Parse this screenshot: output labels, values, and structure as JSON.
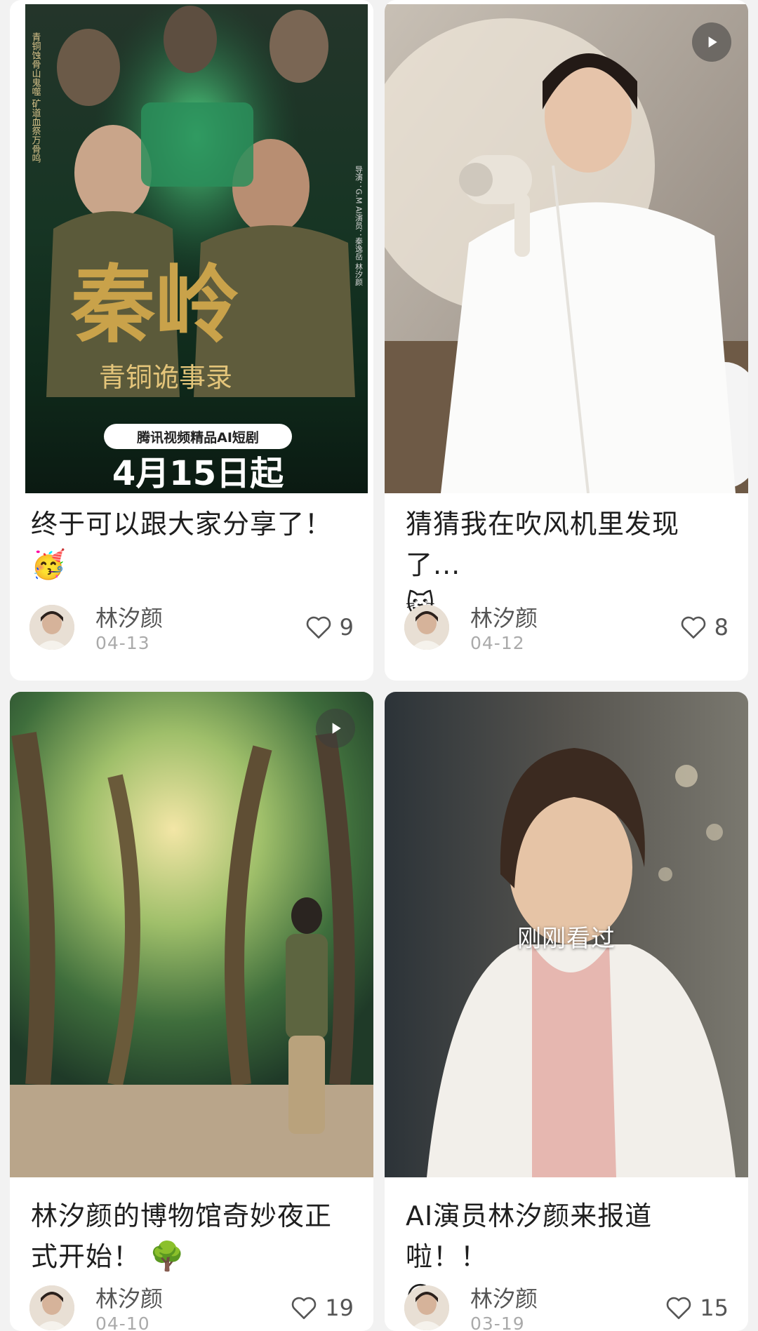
{
  "cards": [
    {
      "title": "终于可以跟大家分享了！",
      "emoji": "🥳",
      "author": "林汐颜",
      "date": "04-13",
      "likes": "9",
      "poster": {
        "vertical_left": "青铜蚀骨山鬼噬 矿道血祭万骨鸣",
        "vertical_right": "导演：G.M AI演员：秦逸岳 林汐颜",
        "logo_main": "秦岭",
        "logo_sub": "青铜诡事录",
        "badge": "腾讯视频精品AI短剧",
        "date_line": "4月15日起"
      }
    },
    {
      "title": "猜猜我在吹风机里发现了...",
      "emoji": "😺",
      "author": "林汐颜",
      "date": "04-12",
      "likes": "8",
      "has_play_icon": true
    },
    {
      "title": "林汐颜的博物馆奇妙夜正式开始！",
      "emoji": "🌳",
      "author": "林汐颜",
      "date": "04-10",
      "likes": "19",
      "has_play_icon": true
    },
    {
      "title": "AI演员林汐颜来报道啦！！",
      "emoji": "😊",
      "author": "林汐颜",
      "date": "03-19",
      "likes": "15",
      "overlay_label": "刚刚看过"
    }
  ],
  "icons": {
    "play": "play-icon",
    "heart": "heart-outline-icon"
  },
  "colors": {
    "background": "#f2f2f2",
    "card": "#ffffff",
    "poster_green": "#1f5a3a",
    "poster_gold": "#c9a24a"
  }
}
